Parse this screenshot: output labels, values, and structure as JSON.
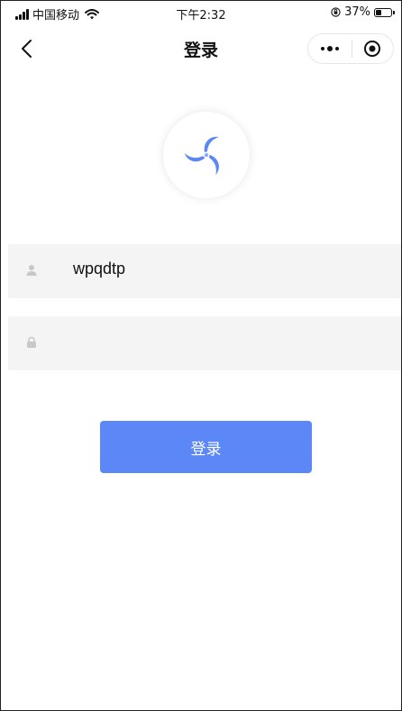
{
  "status_bar": {
    "carrier": "中国移动",
    "time": "下午2:32",
    "battery_text": "37%",
    "battery_level": 0.37
  },
  "nav": {
    "title": "登录",
    "more_icon": "more-dots-icon",
    "close_icon": "target-circle-icon",
    "back_icon": "chevron-left-icon"
  },
  "form": {
    "username_value": "wpqdtp",
    "password_value": ""
  },
  "login_button": {
    "label": "登录",
    "color": "#5b87f7"
  },
  "logo": {
    "icon": "pinwheel-logo-icon",
    "color": "#5b87f7"
  }
}
